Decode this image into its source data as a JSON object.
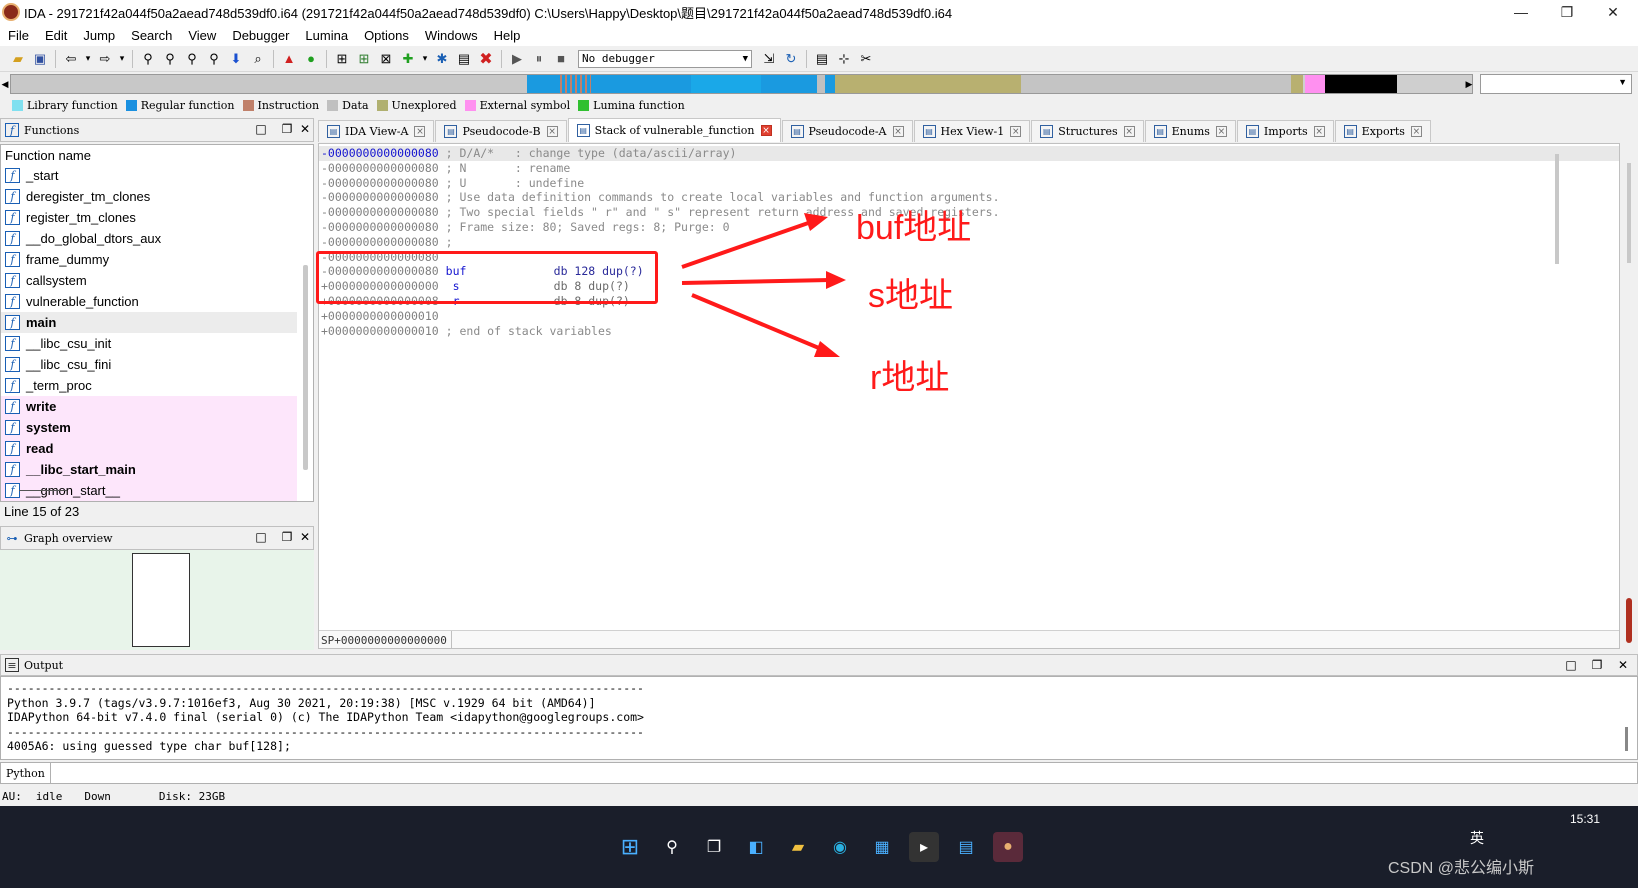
{
  "window": {
    "title": "IDA - 291721f42a044f50a2aead748d539df0.i64 (291721f42a044f50a2aead748d539df0) C:\\Users\\Happy\\Desktop\\题目\\291721f42a044f50a2aead748d539df0.i64",
    "minimize": "—",
    "restore": "❐",
    "close": "✕"
  },
  "menu": [
    "File",
    "Edit",
    "Jump",
    "Search",
    "View",
    "Debugger",
    "Lumina",
    "Options",
    "Windows",
    "Help"
  ],
  "toolbar": {
    "debugger": "No debugger"
  },
  "legend": [
    {
      "label": "Library function",
      "color": "#80e0f0"
    },
    {
      "label": "Regular function",
      "color": "#1a90e0"
    },
    {
      "label": "Instruction",
      "color": "#c0806a"
    },
    {
      "label": "Data",
      "color": "#c0c0c0"
    },
    {
      "label": "Unexplored",
      "color": "#b0b070"
    },
    {
      "label": "External symbol",
      "color": "#ff90f0"
    },
    {
      "label": "Lumina function",
      "color": "#30c030"
    }
  ],
  "functions_panel": {
    "title": "Functions",
    "column": "Function name",
    "items": [
      {
        "name": "_start",
        "bold": false,
        "pink": false
      },
      {
        "name": "deregister_tm_clones",
        "bold": false,
        "pink": false
      },
      {
        "name": "register_tm_clones",
        "bold": false,
        "pink": false
      },
      {
        "name": "__do_global_dtors_aux",
        "bold": false,
        "pink": false
      },
      {
        "name": "frame_dummy",
        "bold": false,
        "pink": false
      },
      {
        "name": "callsystem",
        "bold": false,
        "pink": false
      },
      {
        "name": "vulnerable_function",
        "bold": false,
        "pink": false
      },
      {
        "name": "main",
        "bold": true,
        "pink": false
      },
      {
        "name": "__libc_csu_init",
        "bold": false,
        "pink": false
      },
      {
        "name": "__libc_csu_fini",
        "bold": false,
        "pink": false
      },
      {
        "name": "_term_proc",
        "bold": false,
        "pink": false
      },
      {
        "name": "write",
        "bold": true,
        "pink": true
      },
      {
        "name": "system",
        "bold": true,
        "pink": true
      },
      {
        "name": "read",
        "bold": true,
        "pink": true
      },
      {
        "name": "__libc_start_main",
        "bold": true,
        "pink": true
      },
      {
        "name": "__gmon_start__",
        "bold": false,
        "pink": true
      }
    ],
    "line_status": "Line 15 of 23"
  },
  "graph_overview": {
    "title": "Graph overview"
  },
  "tabs": [
    {
      "label": "IDA View-A",
      "active": false
    },
    {
      "label": "Pseudocode-B",
      "active": false
    },
    {
      "label": "Stack of vulnerable_function",
      "active": true
    },
    {
      "label": "Pseudocode-A",
      "active": false
    },
    {
      "label": "Hex View-1",
      "active": false
    },
    {
      "label": "Structures",
      "active": false
    },
    {
      "label": "Enums",
      "active": false
    },
    {
      "label": "Imports",
      "active": false
    },
    {
      "label": "Exports",
      "active": false
    }
  ],
  "stack_view": {
    "lines": [
      {
        "addr": "-0000000000000080",
        "name": "",
        "text": "; D/A/*   : change type (data/ascii/array)"
      },
      {
        "addr": "-0000000000000080",
        "name": "",
        "text": "; N       : rename"
      },
      {
        "addr": "-0000000000000080",
        "name": "",
        "text": "; U       : undefine"
      },
      {
        "addr": "-0000000000000080",
        "name": "",
        "text": "; Use data definition commands to create local variables and function arguments."
      },
      {
        "addr": "-0000000000000080",
        "name": "",
        "text": "; Two special fields \" r\" and \" s\" represent return address and saved registers."
      },
      {
        "addr": "-0000000000000080",
        "name": "",
        "text": "; Frame size: 80; Saved regs: 8; Purge: 0"
      },
      {
        "addr": "-0000000000000080",
        "name": "",
        "text": ";"
      },
      {
        "addr": "-0000000000000080",
        "name": "",
        "text": ""
      },
      {
        "addr": "-0000000000000080",
        "name": "buf",
        "text": "db 128 dup(?)"
      },
      {
        "addr": "+0000000000000000",
        "name": " s",
        "text": "db 8 dup(?)"
      },
      {
        "addr": "+0000000000000008",
        "name": " r",
        "text": "db 8 dup(?)"
      },
      {
        "addr": "+0000000000000010",
        "name": "",
        "text": ""
      },
      {
        "addr": "+0000000000000010",
        "name": "",
        "text": "; end of stack variables"
      }
    ],
    "sp_status": "SP+0000000000000000"
  },
  "annotations": {
    "buf": "buf地址",
    "s": "s地址",
    "r": "r地址"
  },
  "output": {
    "title": "Output",
    "lines": [
      "--------------------------------------------------------------------------------------------",
      "Python 3.9.7 (tags/v3.9.7:1016ef3, Aug 30 2021, 20:19:38) [MSC v.1929 64 bit (AMD64)]",
      "IDAPython 64-bit v7.4.0 final (serial 0) (c) The IDAPython Team <idapython@googlegroups.com>",
      "--------------------------------------------------------------------------------------------",
      "4005A6: using guessed type char buf[128];"
    ],
    "language": "Python"
  },
  "status": {
    "au": "AU:",
    "state": "idle",
    "direction": "Down",
    "disk": "Disk: 23GB"
  },
  "taskbar": {
    "time": "15:31",
    "lang": "英",
    "watermark": "CSDN @悲公编小斯"
  }
}
